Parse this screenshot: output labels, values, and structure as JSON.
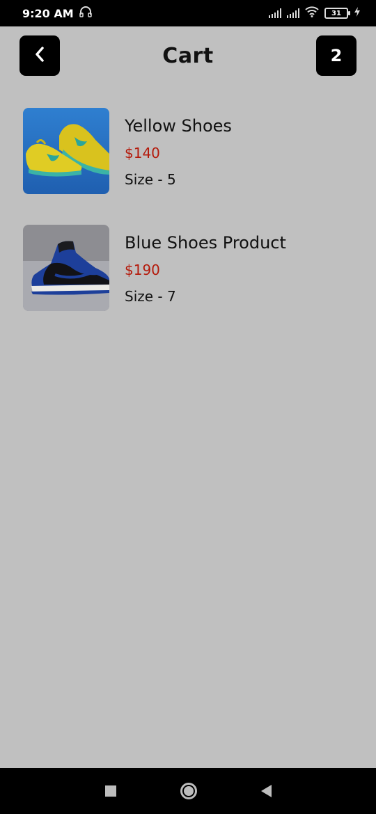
{
  "status_bar": {
    "time": "9:20 AM",
    "battery": "31",
    "icons": [
      "headphones-icon",
      "signal-icon",
      "signal-icon",
      "wifi-icon",
      "battery-icon",
      "charging-icon"
    ]
  },
  "header": {
    "title": "Cart",
    "back_icon": "chevron-left-icon",
    "item_count": "2"
  },
  "cart": {
    "items": [
      {
        "name": "Yellow Shoes",
        "price": "$140",
        "size": "Size - 5"
      },
      {
        "name": "Blue Shoes Product",
        "price": "$190",
        "size": "Size - 7"
      }
    ]
  },
  "colors": {
    "background": "#c0c0c0",
    "header_button": "#000000",
    "price": "#b41a0b"
  },
  "nav_bar": {
    "icons": [
      "recent-apps-icon",
      "home-icon",
      "back-icon"
    ]
  }
}
